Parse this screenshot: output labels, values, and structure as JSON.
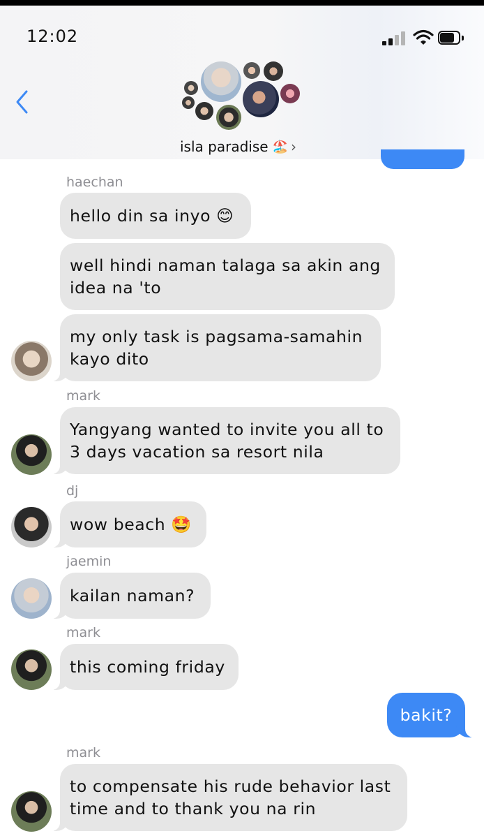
{
  "status": {
    "time": "12:02"
  },
  "group": {
    "title": "isla paradise",
    "emoji": "🏖️",
    "chevron": "›"
  },
  "messages": {
    "names": {
      "n1": "haechan",
      "n2": "mark",
      "n3": "dj",
      "n4": "jaemin",
      "n5": "mark",
      "n6": "mark"
    },
    "m1": "hello din sa inyo 😊",
    "m2": "well hindi naman talaga sa akin ang idea na 'to",
    "m3": "my only task is pagsama-samahin kayo dito",
    "m4": "Yangyang wanted to invite you all to 3 days vacation sa resort nila",
    "m5": "wow beach 🤩",
    "m6": "kailan naman?",
    "m7": "this coming friday",
    "m8": "bakit?",
    "m9": "to compensate his rude behavior last time and to thank you na rin"
  },
  "colors": {
    "sent_bubble": "#3d89f5",
    "received_bubble": "#e6e6e6",
    "sender_name": "#8e8e93",
    "back_chevron": "#3d89f5"
  }
}
